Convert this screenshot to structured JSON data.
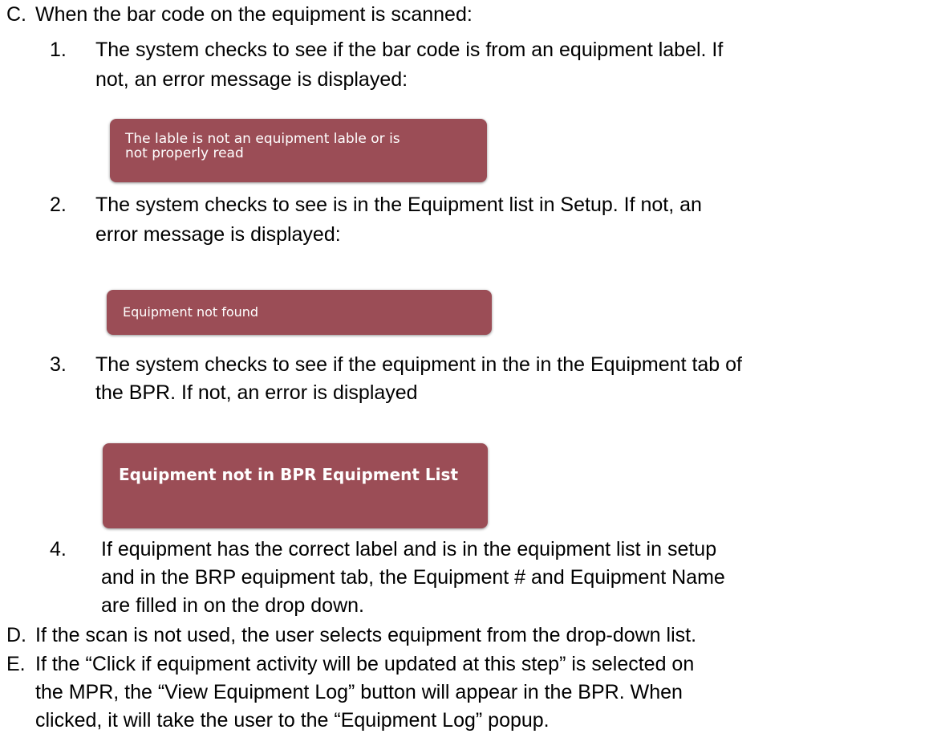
{
  "doc": {
    "item_c": {
      "marker": "C.",
      "text": "When the bar code on the equipment is scanned:"
    },
    "sub1": {
      "marker": "1.",
      "line1": "The system checks to see if the bar code is from an equipment label.  If",
      "line2": "not, an error message is displayed:",
      "error": "The lable is not an equipment lable or is\nnot properly read"
    },
    "sub2": {
      "marker": "2.",
      "line1": " The system checks to see is in the Equipment list in Setup.  If not, an",
      "line2": "error message is displayed:",
      "error": "Equipment not found"
    },
    "sub3": {
      "marker": "3.",
      "line1": "The system checks to see if the equipment in the in the Equipment tab of",
      "line2": "the BPR.  If not, an error is displayed",
      "error": "Equipment not in BPR Equipment List"
    },
    "sub4": {
      "marker": "4.",
      "line1": "If equipment has the correct label and is in the equipment list in setup",
      "line2": "and in the BRP equipment tab, the Equipment # and Equipment Name",
      "line3": "are filled in on the drop down."
    },
    "item_d": {
      "marker": "D.",
      "text": "If the scan is not used, the user selects equipment from the drop-down list."
    },
    "item_e": {
      "marker": "E.",
      "line1": "If the “Click if equipment activity will be updated at this step” is selected on",
      "line2": "the MPR, the “View Equipment Log” button will appear in the BPR.  When",
      "line3": "clicked, it will take the user to the “Equipment Log” popup."
    }
  },
  "colors": {
    "error_background": "#9b4d56",
    "error_text": "#ffffff"
  }
}
